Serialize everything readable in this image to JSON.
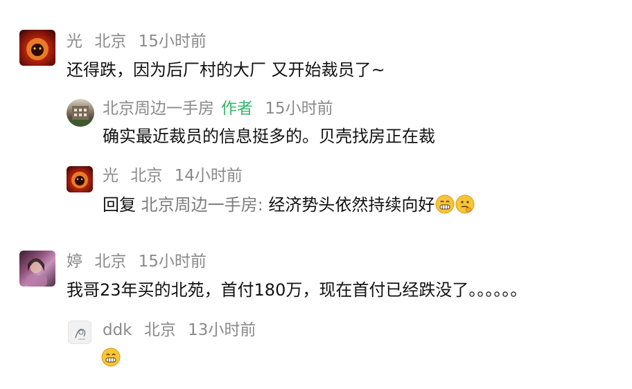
{
  "comments": [
    {
      "user": "光",
      "location": "北京",
      "time": "15小时前",
      "text": "还得跌，因为后厂村的大厂 又开始裁员了~",
      "avatar": "lion-avatar"
    }
  ],
  "reply1": {
    "user": "北京周边一手房",
    "author_tag": "作者",
    "time": "15小时前",
    "text": "确实最近裁员的信息挺多的。贝壳找房正在裁",
    "avatar": "building-avatar"
  },
  "reply2": {
    "user": "光",
    "location": "北京",
    "time": "14小时前",
    "prefix": "回复 ",
    "reply_to": "北京周边一手房:",
    "text": " 经济势头依然持续向好",
    "emojis": [
      "grin-emoji",
      "thinking-emoji"
    ],
    "avatar": "lion-avatar"
  },
  "comment2": {
    "user": "婷",
    "location": "北京",
    "time": "15小时前",
    "text": "我哥23年买的北苑，首付180万，现在首付已经跌没了。。。。。。",
    "avatar": "girl-avatar"
  },
  "reply3": {
    "user": "ddk",
    "location": "北京",
    "time": "13小时前",
    "emojis": [
      "grin-emoji"
    ],
    "avatar": "sketch-avatar"
  },
  "colors": {
    "meta": "#8a8a8a",
    "author_tag": "#35b76a",
    "text": "#111111",
    "reply_target": "#7d7d7d"
  }
}
